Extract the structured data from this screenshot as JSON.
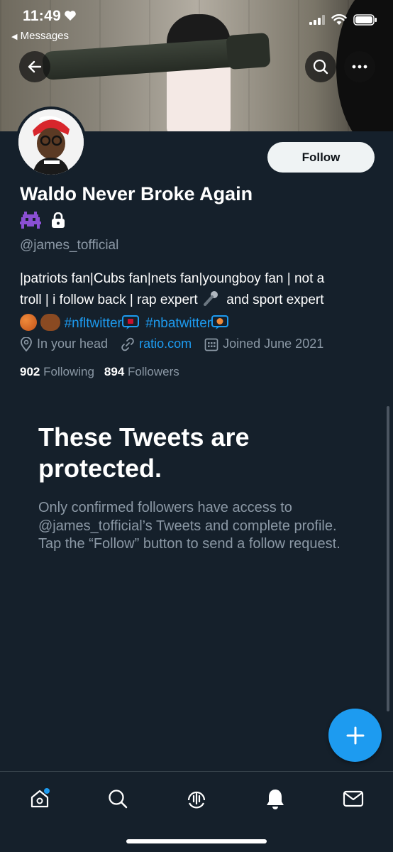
{
  "status_bar": {
    "time": "11:49",
    "back_app_label": "Messages"
  },
  "profile": {
    "display_name": "Waldo Never Broke Again",
    "handle": "@james_tofficial",
    "follow_label": "Follow",
    "bio": {
      "line1": "|patriots fan|Cubs fan|nets fan|youngboy fan | not a",
      "line2_a": "troll | i follow back | rap expert",
      "line2_b": "and sport expert",
      "tag1": "#nfltwitter",
      "tag2": "#nbatwitter"
    },
    "location": "In your head",
    "website": "ratio.com",
    "joined": "Joined June 2021",
    "following_count": "902",
    "following_label": "Following",
    "followers_count": "894",
    "followers_label": "Followers"
  },
  "protected": {
    "title": "These Tweets are protected.",
    "body": "Only confirmed followers have access to @james_tofficial’s Tweets and complete profile. Tap the “Follow” button to send a follow request."
  },
  "icons": {
    "header": [
      "back-arrow-icon",
      "search-icon",
      "more-icon"
    ],
    "tabs": [
      "home-icon",
      "search-icon",
      "spaces-icon",
      "notifications-icon",
      "messages-icon"
    ],
    "compose": "plus-icon"
  },
  "colors": {
    "background": "#15202b",
    "accent": "#1d9bf0",
    "secondary_text": "#8b98a5"
  }
}
